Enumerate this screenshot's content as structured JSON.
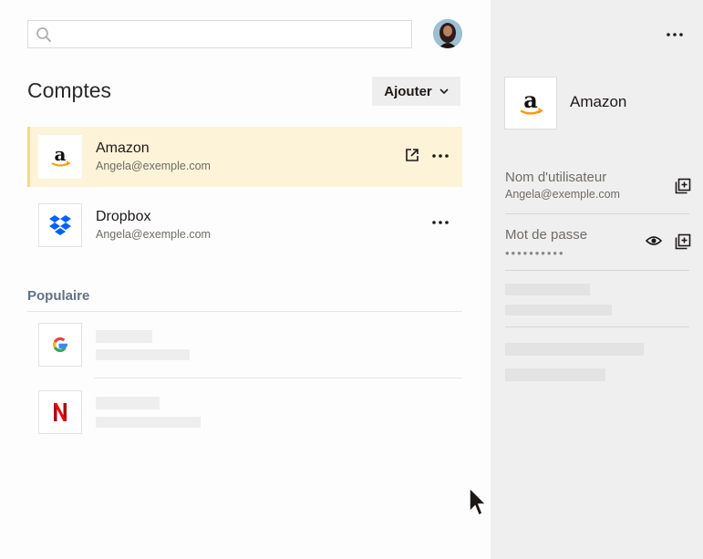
{
  "search": {
    "placeholder": ""
  },
  "main": {
    "title": "Comptes",
    "add_button": "Ajouter",
    "accounts": [
      {
        "name": "Amazon",
        "email": "Angela@exemple.com",
        "icon": "amazon-logo",
        "selected": true
      },
      {
        "name": "Dropbox",
        "email": "Angela@exemple.com",
        "icon": "dropbox-logo",
        "selected": false
      }
    ],
    "popular_label": "Populaire",
    "popular": [
      {
        "icon": "google-logo"
      },
      {
        "icon": "netflix-logo"
      }
    ]
  },
  "detail": {
    "name": "Amazon",
    "username_label": "Nom d'utilisateur",
    "username_value": "Angela@exemple.com",
    "password_label": "Mot de passe",
    "password_mask": "••••••••••"
  },
  "colors": {
    "selected_row": "#fdf3d8",
    "selected_border": "#f3d98e",
    "dropbox_blue": "#0061fe",
    "amazon_orange": "#ff9900",
    "netflix_red": "#e50914",
    "panel_bg": "#efefef"
  }
}
